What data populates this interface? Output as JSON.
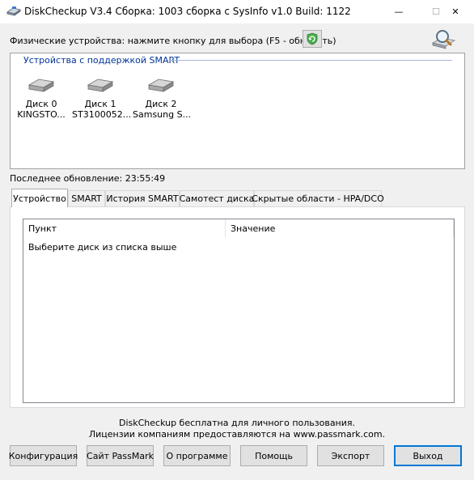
{
  "window": {
    "title": "DiskCheckup V3.4 Сборка: 1003 сборка с SysInfo v1.0 Build: 1122",
    "minimize_glyph": "—",
    "maximize_glyph": "☐",
    "close_glyph": "✕"
  },
  "header": {
    "physical_devices_label": "Физические устройства: нажмите кнопку для выбора (F5 - обновить)"
  },
  "devices": {
    "group_title": "Устройства с поддержкой SMART",
    "items": [
      {
        "name": "Диск 0",
        "model": "KINGSTO..."
      },
      {
        "name": "Диск 1",
        "model": "ST3100052..."
      },
      {
        "name": "Диск 2",
        "model": "Samsung S..."
      }
    ]
  },
  "status": {
    "last_update": "Последнее обновление: 23:55:49"
  },
  "tabs": [
    {
      "label": "Устройство",
      "active": true
    },
    {
      "label": "SMART",
      "active": false
    },
    {
      "label": "История SMART",
      "active": false
    },
    {
      "label": "Самотест диска",
      "active": false
    },
    {
      "label": "Скрытые области - HPA/DCO",
      "active": false
    }
  ],
  "list": {
    "columns": [
      "Пункт",
      "Значение"
    ],
    "message": "Выберите диск из списка выше"
  },
  "footer": {
    "line1": "DiskCheckup бесплатна для личного пользования.",
    "line2": "Лицензии компаниям предоставляются на www.passmark.com."
  },
  "buttons": {
    "config": "Конфигурация",
    "passmark": "Сайт PassMark",
    "about": "О программе",
    "help": "Помощь",
    "export": "Экспорт",
    "exit": "Выход"
  },
  "colors": {
    "group_title": "#003399",
    "default_button_border": "#0078d7",
    "refresh_icon": "#4caf50"
  }
}
